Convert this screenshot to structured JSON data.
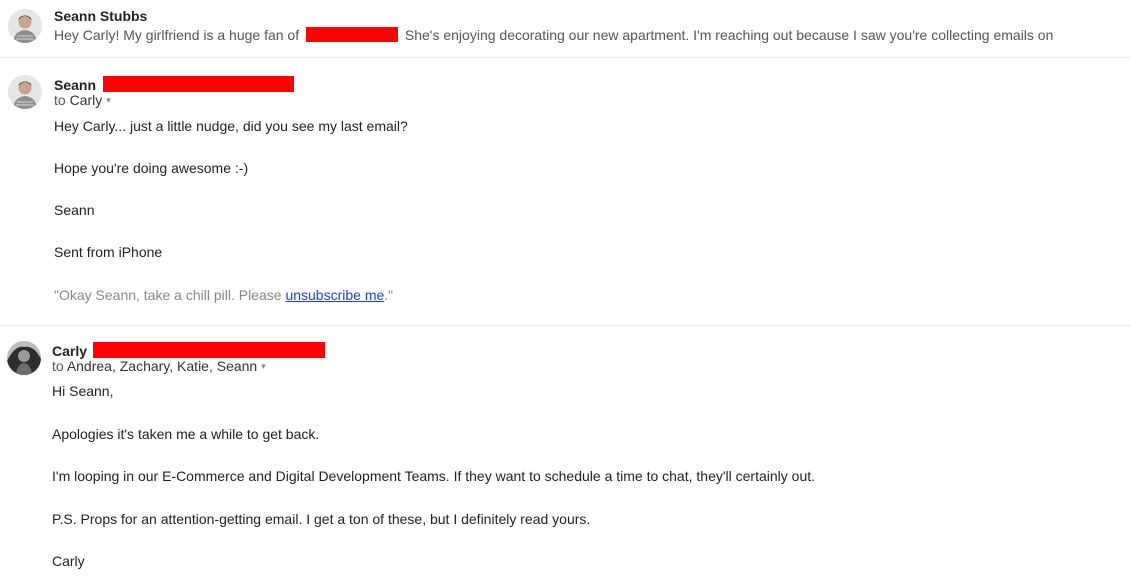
{
  "thread": {
    "collapsed_message": {
      "sender": "Seann Stubbs",
      "snippet_before": "Hey Carly! My girlfriend is a huge fan of",
      "snippet_after": "She's enjoying decorating our new apartment. I'm reaching out because I saw you're collecting emails on"
    },
    "message_seann": {
      "sender": "Seann",
      "to_prefix": "to",
      "to_names": "Carly",
      "caret": "▾",
      "lines": [
        "Hey Carly... just a little nudge, did you see my last email?",
        "Hope you're doing awesome :-)",
        "Seann",
        "Sent from iPhone"
      ],
      "quote_before": "\"Okay Seann, take a chill pill. Please ",
      "quote_link": "unsubscribe me",
      "quote_after": ".\""
    },
    "message_carly": {
      "sender": "Carly",
      "to_prefix": "to",
      "to_names": "Andrea, Zachary, Katie, Seann",
      "caret": "▾",
      "lines": [
        "Hi Seann,",
        "Apologies it's taken me a while to get back.",
        "I'm looping in our E-Commerce and Digital Development Teams. If they want to schedule a time to chat, they'll certainly out.",
        "P.S. Props for an attention-getting email. I get a ton of these, but I definitely read yours.",
        "Carly"
      ]
    }
  },
  "colors": {
    "redaction": "#ff0000",
    "link": "#1a46c8",
    "quote_text": "#888888"
  }
}
